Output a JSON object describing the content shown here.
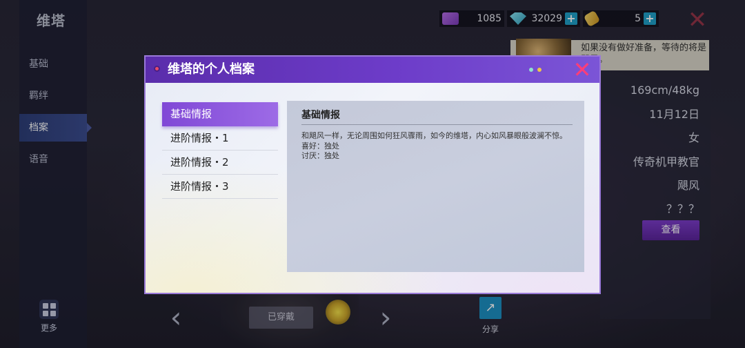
{
  "character": {
    "name": "维塔"
  },
  "sidebar": {
    "items": [
      {
        "label": "基础"
      },
      {
        "label": "羁绊"
      },
      {
        "label": "档案"
      },
      {
        "label": "语音"
      }
    ],
    "more_label": "更多"
  },
  "currencies": [
    {
      "icon": "purple-ticket-icon",
      "value": "1085",
      "color": "#a257d6"
    },
    {
      "icon": "diamond-icon",
      "value": "32029",
      "color": "#3fc0d6"
    },
    {
      "icon": "stamina-icon",
      "value": "5",
      "color": "#e8b93a"
    }
  ],
  "speech": {
    "text": "如果没有做好准备，等待的将是飓风。"
  },
  "info": {
    "values": [
      "169cm/48kg",
      "11月12日",
      "女",
      "传奇机甲教官",
      "飓风",
      "？？？"
    ],
    "view_button": "查看"
  },
  "bottom": {
    "worn_button": "已穿戴",
    "share_label": "分享"
  },
  "modal": {
    "title": "维塔的个人档案",
    "tabs": [
      {
        "label": "基础情报"
      },
      {
        "label": "进阶情报・1"
      },
      {
        "label": "进阶情报・2"
      },
      {
        "label": "进阶情报・3"
      }
    ],
    "content": {
      "title": "基础情报",
      "lines": [
        "和飓风一样，无论周围如何狂风骤雨，如今的维塔，内心如风暴眼般波澜不惊。",
        "喜好：独处",
        "讨厌：独处"
      ]
    }
  },
  "colors": {
    "accent": "#7b45d1",
    "close": "#ff3e77",
    "tab_active": "#8a52dc"
  }
}
